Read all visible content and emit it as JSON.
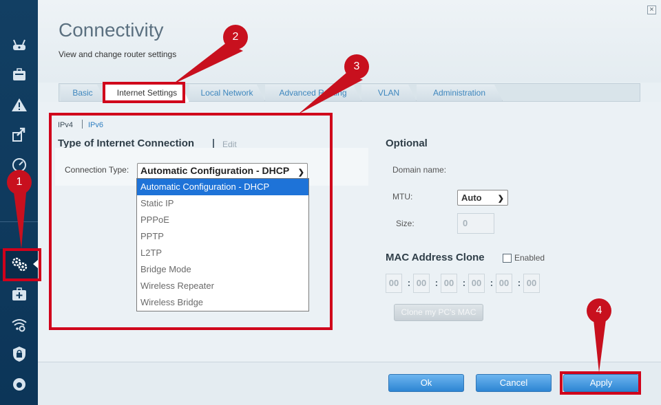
{
  "window": {
    "title": "Connectivity",
    "subtitle": "View and change router settings",
    "close_glyph": "×"
  },
  "sidebar": {
    "items": [
      {
        "icon": "router-icon"
      },
      {
        "icon": "toolbox-icon"
      },
      {
        "icon": "warning-network-icon"
      },
      {
        "icon": "share-arrow-icon"
      },
      {
        "icon": "speedometer-icon"
      },
      {
        "icon": "device-icon"
      },
      {
        "icon": "gears-icon",
        "active": true
      },
      {
        "icon": "medical-kit-icon"
      },
      {
        "icon": "wifi-gear-icon"
      },
      {
        "icon": "lock-shield-icon"
      },
      {
        "icon": "parental-icon"
      }
    ]
  },
  "tabs": [
    {
      "label": "Basic"
    },
    {
      "label": "Internet Settings",
      "active": true
    },
    {
      "label": "Local Network"
    },
    {
      "label": "Advanced Routing"
    },
    {
      "label": "VLAN"
    },
    {
      "label": "Administration"
    }
  ],
  "ip_toggle": {
    "v4": "IPv4",
    "v6": "IPv6"
  },
  "connection": {
    "section_title": "Type of Internet Connection",
    "edit_label": "Edit",
    "label": "Connection Type:",
    "selected": "Automatic Configuration - DHCP",
    "options": [
      "Automatic Configuration - DHCP",
      "Static IP",
      "PPPoE",
      "PPTP",
      "L2TP",
      "Bridge Mode",
      "Wireless Repeater",
      "Wireless Bridge"
    ]
  },
  "optional": {
    "title": "Optional",
    "domain_label": "Domain name:",
    "mtu_label": "MTU:",
    "mtu_value": "Auto",
    "size_label": "Size:",
    "size_value": "0"
  },
  "mac_clone": {
    "title": "MAC Address Clone",
    "enabled_label": "Enabled",
    "octets": [
      "00",
      "00",
      "00",
      "00",
      "00",
      "00"
    ],
    "clone_button": "Clone my PC's MAC"
  },
  "footer": {
    "ok_label": "Ok",
    "cancel_label": "Cancel",
    "apply_label": "Apply"
  },
  "annotations": [
    "1",
    "2",
    "3",
    "4"
  ],
  "colors": {
    "annotation_red": "#d0021b",
    "sidebar_bg": "#0f3a5e",
    "selection_blue": "#1e73d8",
    "button_blue": "#2d85d3"
  }
}
